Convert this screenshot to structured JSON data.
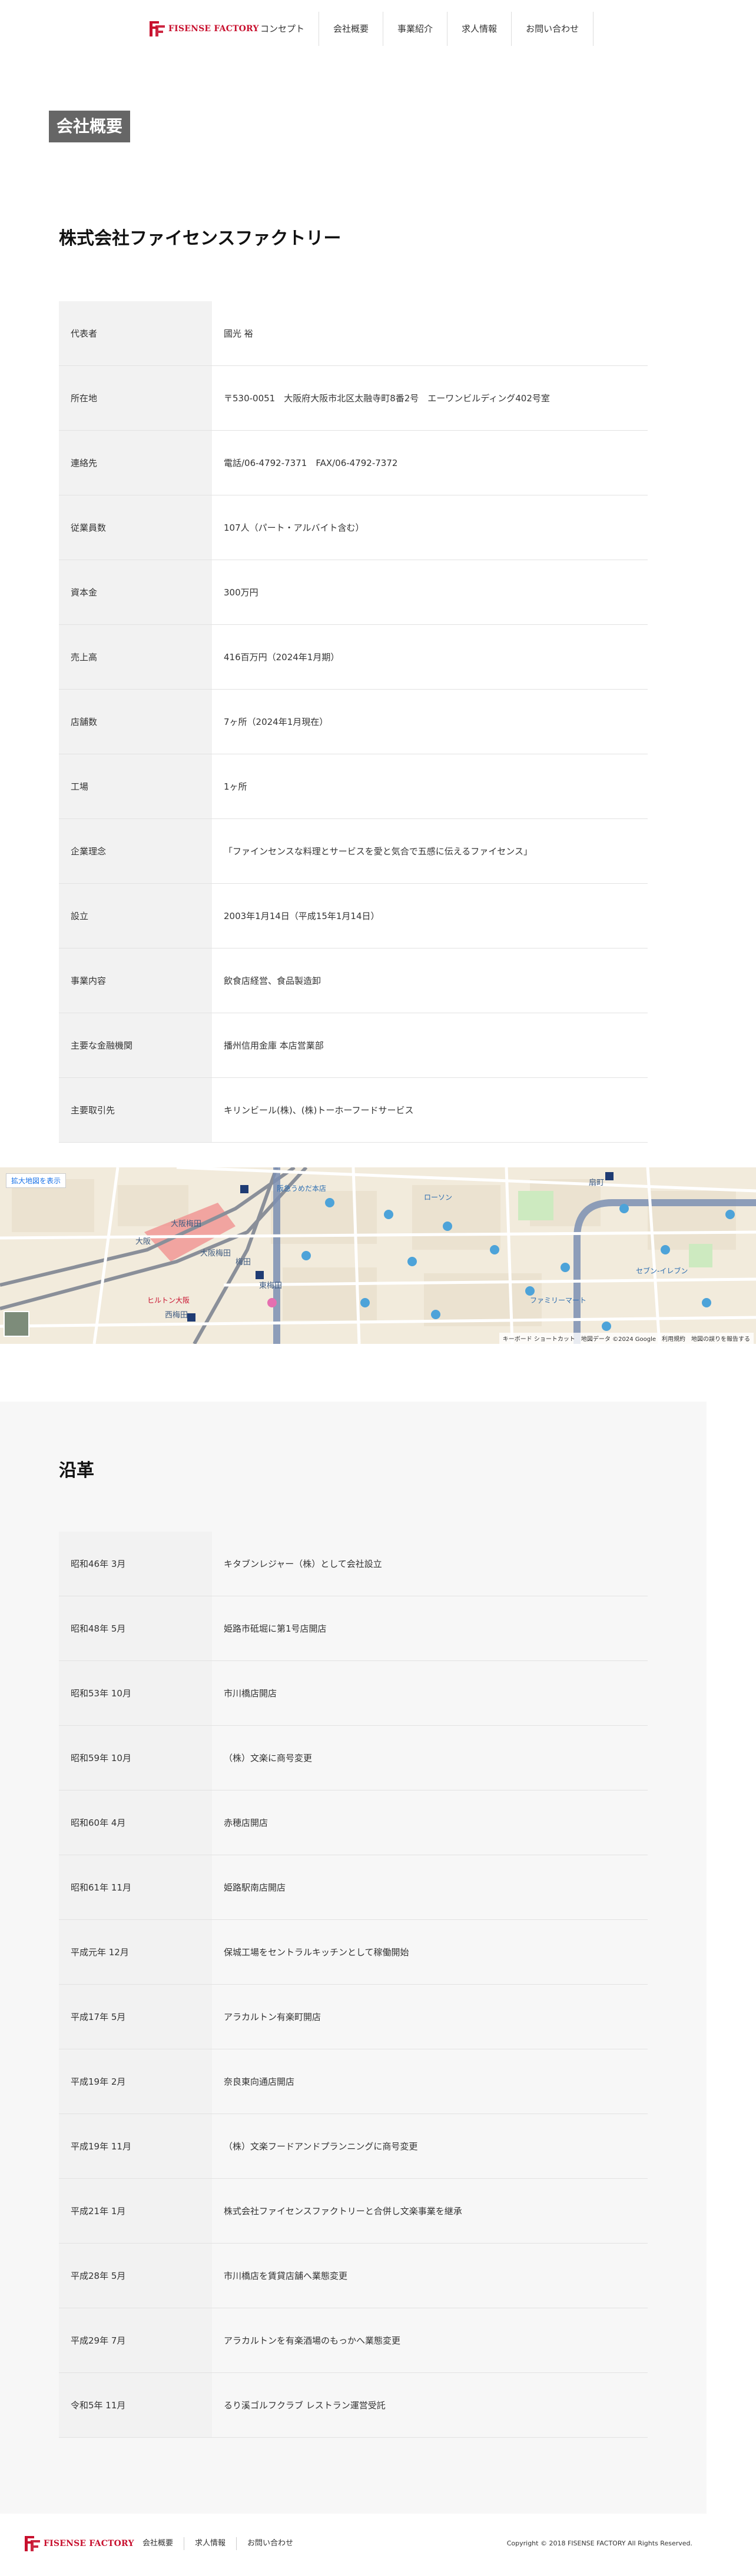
{
  "header": {
    "logo_text": "FISENSE FACTORY",
    "brand_color": "#c8102e",
    "nav": [
      {
        "label": "コンセプト"
      },
      {
        "label": "会社概要"
      },
      {
        "label": "事業紹介"
      },
      {
        "label": "求人情報"
      },
      {
        "label": "お問い合わせ"
      }
    ]
  },
  "page_badge": "会社概要",
  "company": {
    "title": "株式会社ファイセンスファクトリー",
    "rows": [
      {
        "label": "代表者",
        "value": "國光 裕"
      },
      {
        "label": "所在地",
        "value": "〒530-0051　大阪府大阪市北区太融寺町8番2号　エーワンビルディング402号室"
      },
      {
        "label": "連絡先",
        "value": "電話/06-4792-7371　FAX/06-4792-7372"
      },
      {
        "label": "従業員数",
        "value": "107人（パート・アルバイト含む）"
      },
      {
        "label": "資本金",
        "value": "300万円"
      },
      {
        "label": "売上高",
        "value": "416百万円（2024年1月期）"
      },
      {
        "label": "店舗数",
        "value": "7ヶ所（2024年1月現在）"
      },
      {
        "label": "工場",
        "value": "1ヶ所"
      },
      {
        "label": "企業理念",
        "value": "「ファインセンスな料理とサービスを愛と気合で五感に伝えるファイセンス」"
      },
      {
        "label": "設立",
        "value": "2003年1月14日（平成15年1月14日）"
      },
      {
        "label": "事業内容",
        "value": "飲食店経営、食品製造卸"
      },
      {
        "label": "主要な金融機関",
        "value": "播州信用金庫 本店営業部"
      },
      {
        "label": "主要取引先",
        "value": "キリンビール(株)、(株)トーホーフードサービス"
      }
    ]
  },
  "map": {
    "enlarge_link": "拡大地図を表示",
    "attribution": "キーボード ショートカット　地図データ ©2024 Google　利用規約　地図の誤りを報告する",
    "labels": [
      "大阪梅田",
      "大阪",
      "梅田",
      "東梅田",
      "西梅田",
      "大阪梅田",
      "扇町",
      "ヒルトン大阪",
      "ローソン",
      "ファミリーマート",
      "セブン-イレブン",
      "阪急うめだ本店"
    ]
  },
  "history": {
    "title": "沿革",
    "rows": [
      {
        "label": "昭和46年 3月",
        "value": "キタブンレジャー（株）として会社設立"
      },
      {
        "label": "昭和48年 5月",
        "value": "姫路市砥堀に第1号店開店"
      },
      {
        "label": "昭和53年 10月",
        "value": "市川橋店開店"
      },
      {
        "label": "昭和59年 10月",
        "value": "（株）文楽に商号変更"
      },
      {
        "label": "昭和60年 4月",
        "value": "赤穂店開店"
      },
      {
        "label": "昭和61年 11月",
        "value": "姫路駅南店開店"
      },
      {
        "label": "平成元年 12月",
        "value": "保城工場をセントラルキッチンとして稼働開始"
      },
      {
        "label": "平成17年 5月",
        "value": "アラカルトン有楽町開店"
      },
      {
        "label": "平成19年 2月",
        "value": "奈良東向通店開店"
      },
      {
        "label": "平成19年 11月",
        "value": "（株）文楽フードアンドプランニングに商号変更"
      },
      {
        "label": "平成21年 1月",
        "value": "株式会社ファイセンスファクトリーと合併し文楽事業を継承"
      },
      {
        "label": "平成28年 5月",
        "value": "市川橋店を賃貸店舗へ業態変更"
      },
      {
        "label": "平成29年 7月",
        "value": "アラカルトンを有楽酒場のもっかへ業態変更"
      },
      {
        "label": "令和5年 11月",
        "value": "るり溪ゴルフクラブ レストラン運営受託"
      }
    ]
  },
  "footer": {
    "logo_text": "FISENSE FACTORY",
    "nav": [
      {
        "label": "会社概要"
      },
      {
        "label": "求人情報"
      },
      {
        "label": "お問い合わせ"
      }
    ],
    "copyright": "Copyright © 2018 FISENSE FACTORY All Rights Reserved."
  }
}
